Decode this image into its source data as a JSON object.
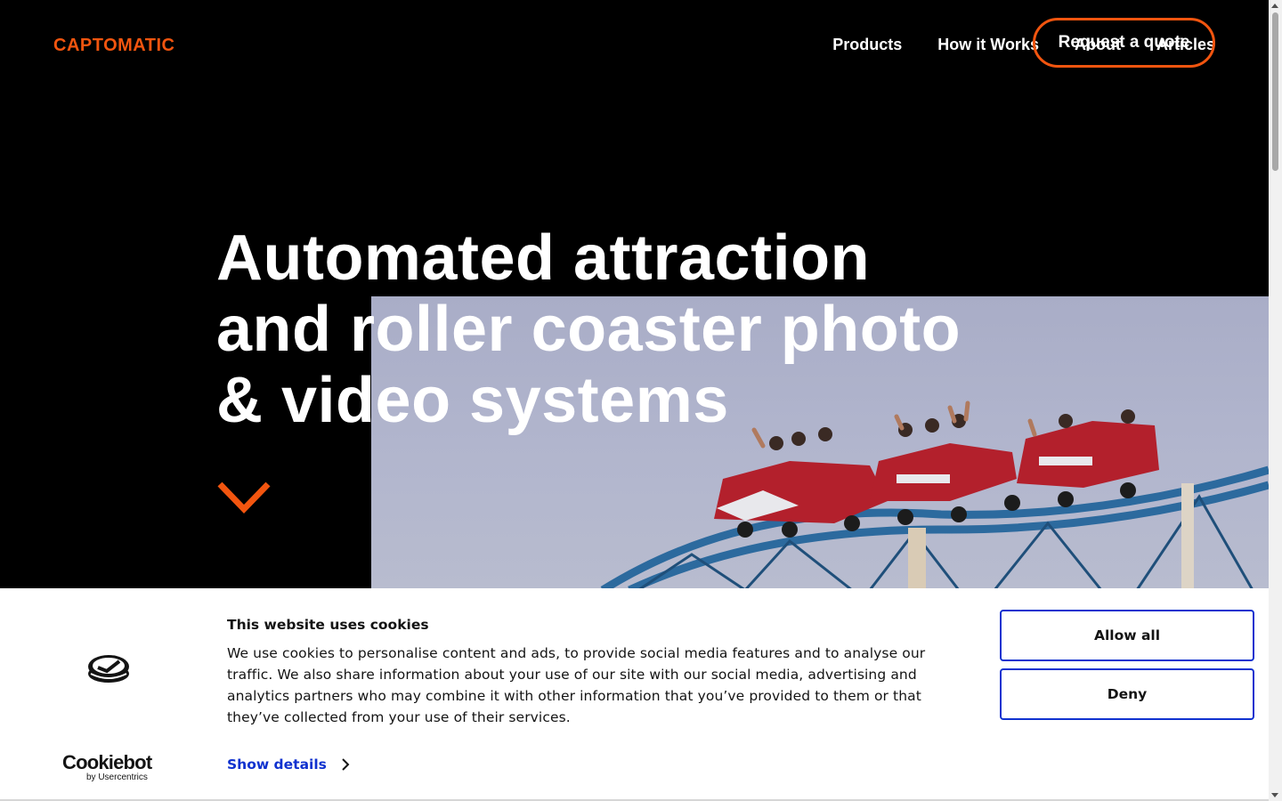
{
  "header": {
    "logo_text": "CAPTOMATIC",
    "nav": [
      {
        "label": "Products"
      },
      {
        "label": "How it Works"
      },
      {
        "label": "About"
      },
      {
        "label": "Articles"
      }
    ],
    "cta_label": "Request a quote"
  },
  "hero": {
    "headline_lines": [
      "Automated attraction",
      "and roller coaster photo",
      "& video systems"
    ]
  },
  "cookie_banner": {
    "title": "This website uses cookies",
    "body": "We use cookies to personalise content and ads, to provide social media features and to analyse our traffic. We also share information about your use of our site with our social media, advertising and analytics partners who may combine it with other information that you’ve provided to them or that they’ve collected from your use of their services.",
    "show_details_label": "Show details",
    "allow_all_label": "Allow all",
    "deny_label": "Deny",
    "brand_name": "Cookiebot",
    "brand_sub": "by Usercentrics"
  },
  "colors": {
    "accent": "#f2550f",
    "cookie_link": "#1032cf",
    "background": "#000000"
  },
  "icons": {
    "scroll_cue": "chevron-down-icon",
    "details": "chevron-right-icon",
    "cookie_logo": "cookiebot-logo-icon"
  }
}
